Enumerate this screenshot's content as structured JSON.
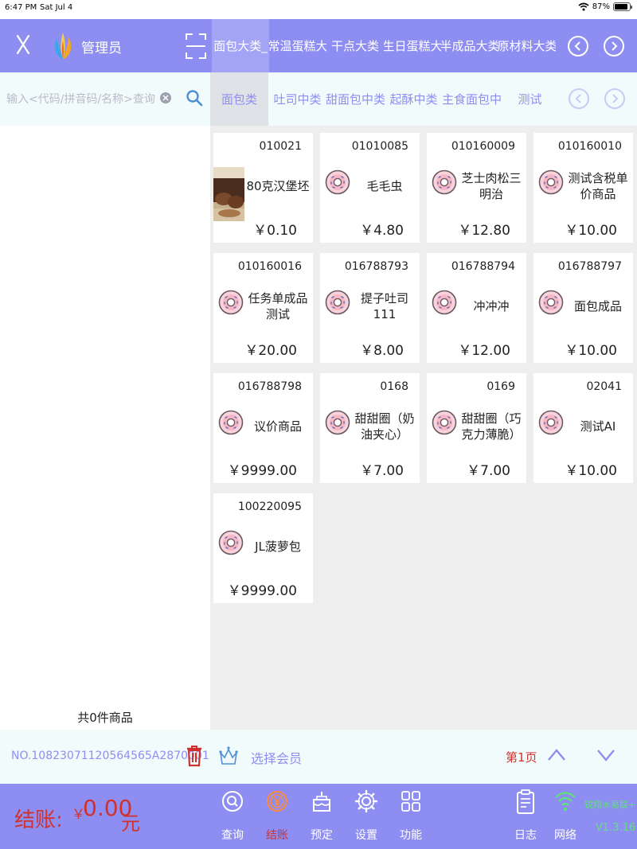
{
  "status_bar": {
    "time": "6:47 PM",
    "date": "Sat Jul 4",
    "battery": "87%",
    "battery_level": 0.87
  },
  "header": {
    "user_name": "管理员",
    "categories": [
      "面包大类_",
      "常温蛋糕大",
      "干点大类",
      "生日蛋糕大",
      "半成品大类",
      "原材料大类"
    ],
    "active_category": 0
  },
  "search": {
    "placeholder": "输入<代码/拼音码/名称>查询..."
  },
  "left_panel": {
    "count_label": "共0件商品"
  },
  "sub_categories": {
    "items": [
      "面包类",
      "吐司中类",
      "甜面包中类",
      "起酥中类",
      "主食面包中",
      "测试"
    ],
    "active": 0
  },
  "products": [
    {
      "code": "010021",
      "name": "80克汉堡坯",
      "price": "￥0.10",
      "icon": "burger-photo"
    },
    {
      "code": "01010085",
      "name": "毛毛虫",
      "price": "￥4.80",
      "icon": "donut-icon"
    },
    {
      "code": "010160009",
      "name": "芝士肉松三明治",
      "price": "￥12.80",
      "icon": "donut-icon"
    },
    {
      "code": "010160010",
      "name": "测试含税单价商品",
      "price": "￥10.00",
      "icon": "donut-icon"
    },
    {
      "code": "010160016",
      "name": "任务单成品测试",
      "price": "￥20.00",
      "icon": "donut-icon"
    },
    {
      "code": "016788793",
      "name": "提子吐司111",
      "price": "￥8.00",
      "icon": "donut-icon"
    },
    {
      "code": "016788794",
      "name": "冲冲冲",
      "price": "￥12.00",
      "icon": "donut-icon"
    },
    {
      "code": "016788797",
      "name": "面包成品",
      "price": "￥10.00",
      "icon": "donut-icon"
    },
    {
      "code": "016788798",
      "name": "议价商品",
      "price": "￥9999.00",
      "icon": "donut-icon"
    },
    {
      "code": "0168",
      "name": "甜甜圈（奶油夹心）",
      "price": "￥7.00",
      "icon": "donut-icon"
    },
    {
      "code": "0169",
      "name": "甜甜圈（巧克力薄脆）",
      "price": "￥7.00",
      "icon": "donut-icon"
    },
    {
      "code": "02041",
      "name": "测试AI",
      "price": "￥10.00",
      "icon": "donut-icon"
    },
    {
      "code": "100220095",
      "name": "JL菠萝包",
      "price": "￥9999.00",
      "icon": "donut-icon"
    }
  ],
  "info_bar": {
    "order_no": "NO.10823071120564565A2870001",
    "member_label": "选择会员",
    "page_label": "第1页"
  },
  "footer": {
    "checkout_label": "结账:",
    "currency": "￥",
    "amount": "0.00",
    "unit": "元",
    "nav": [
      {
        "key": "query",
        "label": "查询",
        "icon": "search-circle-icon"
      },
      {
        "key": "checkout",
        "label": "结账",
        "icon": "yuan-circle-icon"
      },
      {
        "key": "reserve",
        "label": "预定",
        "icon": "cake-icon"
      },
      {
        "key": "settings",
        "label": "设置",
        "icon": "gear-icon"
      },
      {
        "key": "functions",
        "label": "功能",
        "icon": "grid-icon"
      },
      {
        "key": "log",
        "label": "日志",
        "icon": "clipboard-icon"
      },
      {
        "key": "network",
        "label": "网络",
        "icon": "wifi-icon"
      }
    ],
    "active_nav": 1,
    "brand": "锐翔®易联+",
    "version": "V1.3.16"
  },
  "colors": {
    "primary": "#8e8ef2",
    "accent_red": "#d0312d",
    "panel_bg": "#f2fbfb",
    "brand_green": "#5ee27a"
  }
}
